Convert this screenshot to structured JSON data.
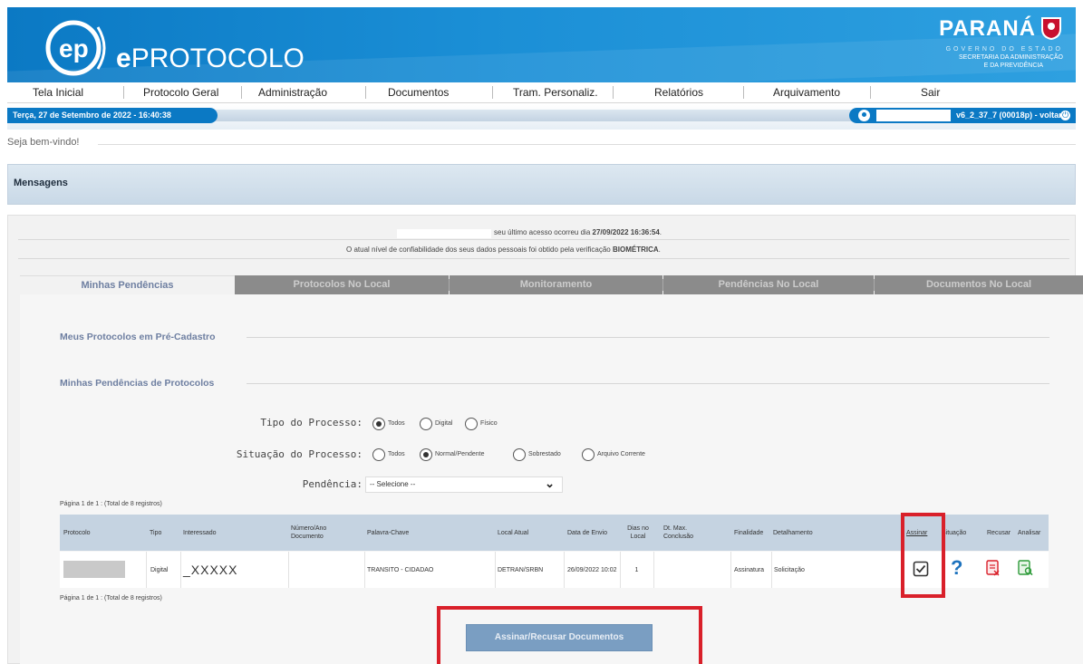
{
  "header": {
    "app_name_prefix": "e",
    "app_name_rest": "PROTOCOLO",
    "logo_letters": "EP",
    "gov_name": "PARANÁ",
    "gov_line1": "GOVERNO DO ESTADO",
    "gov_line2": "SECRETARIA DA ADMINISTRAÇÃO",
    "gov_line3": "E DA PREVIDÊNCIA"
  },
  "menu": [
    "Tela Inicial",
    "Protocolo Geral",
    "Administração",
    "Documentos",
    "Tram. Personaliz.",
    "Relatórios",
    "Arquivamento",
    "Sair"
  ],
  "status": {
    "date": "Terça, 27 de Setembro de 2022 - 16:40:38",
    "version": "v6_2_37_7 (00018p) - voltar",
    "logout_glyph": "⏻"
  },
  "welcome": "Seja bem-vindo!",
  "messages_title": "Mensagens",
  "notice": {
    "last_access_prefix": "seu último acesso ocorreu dia ",
    "last_access_value": "27/09/2022 16:36:54",
    "last_access_suffix": ".",
    "confidentiality_prefix": "O atual nível de confiabilidade dos seus dados pessoais foi obtido pela verificação ",
    "confidentiality_value": "BIOMÉTRICA",
    "confidentiality_suffix": "."
  },
  "tabs": [
    "Minhas Pendências",
    "Protocolos No Local",
    "Monitoramento",
    "Pendências No Local",
    "Documentos No Local"
  ],
  "sections": {
    "pre_cadastro": "Meus Protocolos em Pré-Cadastro",
    "pendencias": "Minhas Pendências de Protocolos"
  },
  "filters": {
    "tipo_label": "Tipo do Processo:",
    "tipo_options": [
      "Todos",
      "Digital",
      "Físico"
    ],
    "situacao_label": "Situação do Processo:",
    "situacao_options": [
      "Todos",
      "Normal/Pendente",
      "Sobrestado",
      "Arquivo Corrente"
    ],
    "pendencia_label": "Pendência:",
    "pendencia_value": "-- Selecione --"
  },
  "pagination": "Página 1 de 1 : (Total de 8 registros)",
  "table": {
    "headers": [
      "Protocolo",
      "Tipo",
      "Interessado",
      "Número/Ano Documento",
      "Palavra-Chave",
      "Local Atual",
      "Data de Envio",
      "Dias no Local",
      "Dt. Max. Conclusão",
      "Finalidade",
      "Detalhamento",
      "Assinar",
      "Situação",
      "Recusar",
      "Analisar"
    ],
    "rows": [
      {
        "protocolo": "",
        "tipo": "Digital",
        "interessado": "_XXXXX",
        "numero": "",
        "palavra_chave": "TRANSITO - CIDADAO",
        "local_atual": "DETRAN/SRBN",
        "data_envio": "26/09/2022 10:02",
        "dias_local": "1",
        "dt_max": "",
        "finalidade": "Assinatura",
        "detalhamento": "Solicitação"
      }
    ]
  },
  "actions": {
    "sign_button": "Assinar/Recusar Documentos"
  },
  "colors": {
    "brand_blue": "#0b79c4",
    "highlight_red": "#d9202a",
    "tab_gray": "#8b8b8b"
  }
}
